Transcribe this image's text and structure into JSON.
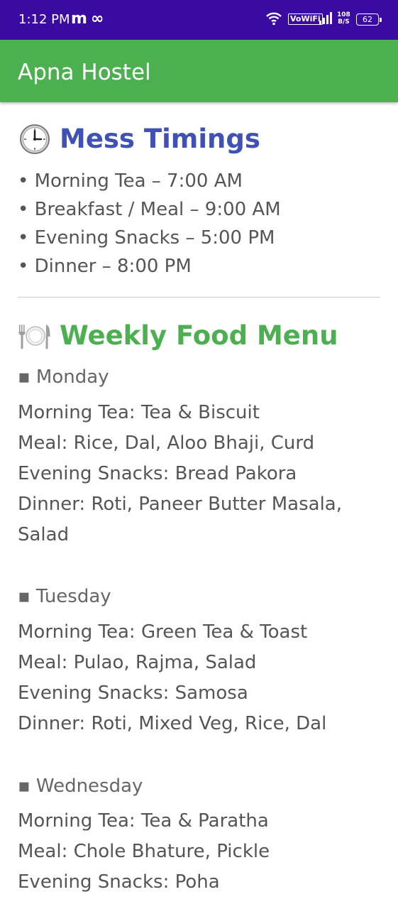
{
  "status_bar": {
    "time": "1:12 PM",
    "notification_icons": [
      "m",
      "∞"
    ],
    "vowifi": "VoWiFi",
    "net_speed_value": "108",
    "net_speed_unit": "B/S",
    "battery": "62"
  },
  "app_bar": {
    "title": "Apna Hostel"
  },
  "mess_timings": {
    "icon": "clock-icon",
    "title": "Mess Timings",
    "items": [
      "• Morning Tea – 7:00 AM",
      "• Breakfast / Meal – 9:00 AM",
      "• Evening Snacks – 5:00 PM",
      "• Dinner – 8:00 PM"
    ]
  },
  "weekly_menu": {
    "icon": "plate-cutlery-icon",
    "title": "Weekly Food Menu",
    "days": [
      {
        "day": "▪ Monday",
        "lines": [
          "Morning Tea: Tea & Biscuit",
          "Meal: Rice, Dal, Aloo Bhaji, Curd",
          "Evening Snacks: Bread Pakora",
          "Dinner: Roti, Paneer Butter Masala,",
          "Salad"
        ]
      },
      {
        "day": "▪ Tuesday",
        "lines": [
          "Morning Tea: Green Tea & Toast",
          "Meal: Pulao, Rajma, Salad",
          "Evening Snacks: Samosa",
          "Dinner: Roti, Mixed Veg, Rice, Dal"
        ]
      },
      {
        "day": "▪ Wednesday",
        "lines": [
          "Morning Tea: Tea & Paratha",
          "Meal: Chole Bhature, Pickle",
          "Evening Snacks: Poha"
        ]
      }
    ]
  },
  "colors": {
    "status_bar": "#3b0aa3",
    "app_bar": "#4caf50",
    "mess_heading": "#3f51b5",
    "menu_heading": "#4caf50",
    "body_text": "#555555"
  }
}
